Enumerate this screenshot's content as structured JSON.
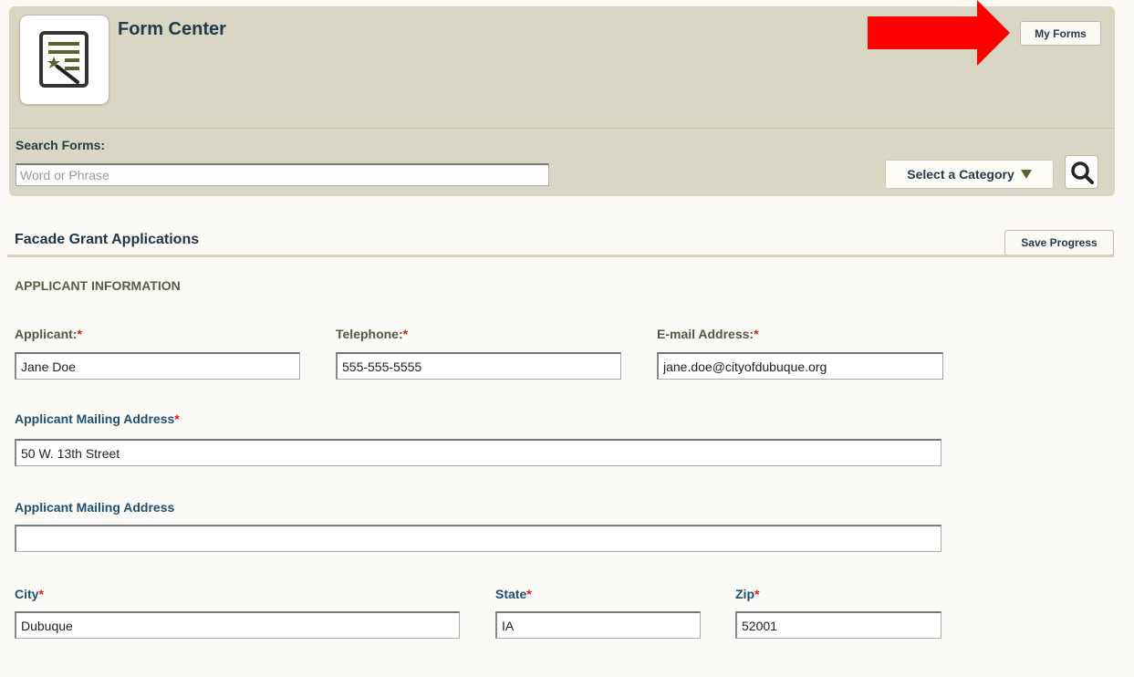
{
  "header": {
    "app_title": "Form Center",
    "my_forms_label": "My Forms",
    "search_label": "Search Forms:",
    "search_placeholder": "Word or Phrase",
    "category_label": "Select a Category",
    "annotation_arrow_color": "#ff0000"
  },
  "form": {
    "title": "Facade Grant Applications",
    "save_label": "Save Progress",
    "section_heading": "APPLICANT INFORMATION",
    "fields": {
      "applicant": {
        "label": "Applicant:",
        "required": "*",
        "value": "Jane Doe"
      },
      "telephone": {
        "label": "Telephone:",
        "required": "*",
        "value": "555-555-5555"
      },
      "email": {
        "label": "E-mail Address:",
        "required": "*",
        "value": "jane.doe@cityofdubuque.org"
      },
      "mailing1": {
        "label": "Applicant Mailing Address",
        "required": "*",
        "value": "50 W. 13th Street"
      },
      "mailing2": {
        "label": "Applicant Mailing Address",
        "value": ""
      },
      "city": {
        "label": "City",
        "required": "*",
        "value": "Dubuque"
      },
      "state": {
        "label": "State",
        "required": "*",
        "value": "IA"
      },
      "zip": {
        "label": "Zip",
        "required": "*",
        "value": "52001"
      }
    }
  },
  "colors": {
    "header_bg": "#d9d6c3",
    "page_bg": "#fbfaf7",
    "title_color": "#233a4a",
    "required_color": "#d21f1f"
  }
}
